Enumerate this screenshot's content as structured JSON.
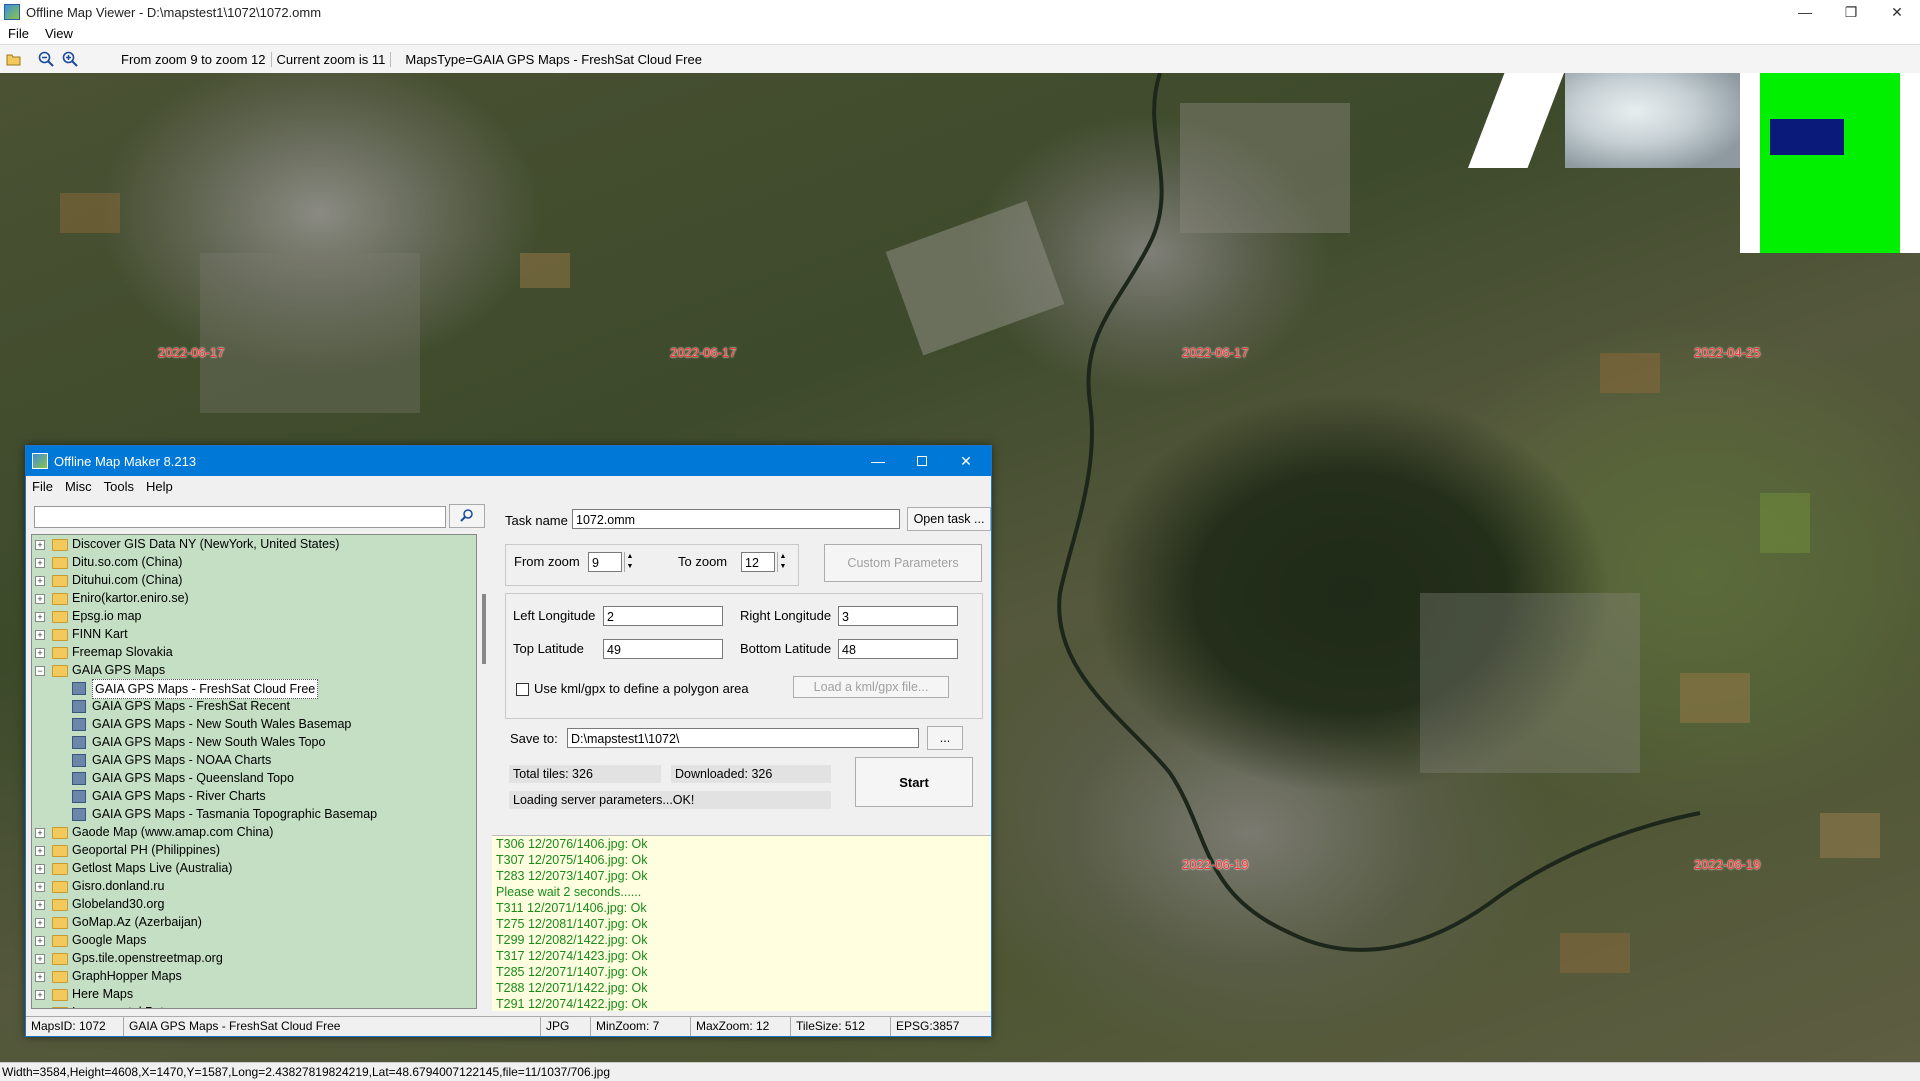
{
  "window": {
    "title": "Offline Map Viewer - D:\\mapstest1\\1072\\1072.omm",
    "minimize": "—",
    "maximize": "❐",
    "close": "✕"
  },
  "menubar": {
    "file": "File",
    "view": "View"
  },
  "toolbar": {
    "zoom_range": "From zoom 9 to zoom 12",
    "current_zoom": "Current zoom is 11",
    "maps_type": "MapsType=GAIA GPS Maps - FreshSat Cloud Free",
    "icons": [
      "folder-open-icon",
      "zoom-out-icon",
      "zoom-in-icon"
    ]
  },
  "map": {
    "date_labels": [
      "2022-06-17",
      "2022-06-17",
      "2022-06-17",
      "2022-04-25",
      "2022-06-19",
      "2022-06-19"
    ]
  },
  "statusbar": {
    "text": "Width=3584,Height=4608,X=1470,Y=1587,Long=2.43827819824219,Lat=48.6794007122145,file=11/1037/706.jpg"
  },
  "dialog": {
    "title": "Offline Map Maker 8.213",
    "menu": [
      "File",
      "Misc",
      "Tools",
      "Help"
    ],
    "search": {
      "value": ""
    },
    "tree": [
      {
        "label": "Discover GIS Data NY (NewYork, United States)",
        "level": 1
      },
      {
        "label": "Ditu.so.com (China)",
        "level": 1
      },
      {
        "label": "Dituhui.com (China)",
        "level": 1
      },
      {
        "label": "Eniro(kartor.eniro.se)",
        "level": 1
      },
      {
        "label": "Epsg.io map",
        "level": 1
      },
      {
        "label": "FINN Kart",
        "level": 1
      },
      {
        "label": "Freemap Slovakia",
        "level": 1
      },
      {
        "label": "GAIA GPS Maps",
        "level": 1,
        "expanded": true
      },
      {
        "label": "GAIA GPS Maps - FreshSat Cloud Free",
        "level": 2,
        "selected": true
      },
      {
        "label": "GAIA GPS Maps - FreshSat Recent",
        "level": 2
      },
      {
        "label": "GAIA GPS Maps - New South Wales Basemap",
        "level": 2
      },
      {
        "label": "GAIA GPS Maps - New South Wales Topo",
        "level": 2
      },
      {
        "label": "GAIA GPS Maps - NOAA Charts",
        "level": 2
      },
      {
        "label": "GAIA GPS Maps - Queensland Topo",
        "level": 2
      },
      {
        "label": "GAIA GPS Maps - River Charts",
        "level": 2
      },
      {
        "label": "GAIA GPS Maps - Tasmania Topographic Basemap",
        "level": 2
      },
      {
        "label": "Gaode Map (www.amap.com China)",
        "level": 1
      },
      {
        "label": "Geoportal PH (Philippines)",
        "level": 1
      },
      {
        "label": "Getlost Maps Live (Australia)",
        "level": 1
      },
      {
        "label": "Gisro.donland.ru",
        "level": 1
      },
      {
        "label": "Globeland30.org",
        "level": 1
      },
      {
        "label": "GoMap.Az (Azerbaijan)",
        "level": 1
      },
      {
        "label": "Google Maps",
        "level": 1
      },
      {
        "label": "Gps.tile.openstreetmap.org",
        "level": 1
      },
      {
        "label": "GraphHopper Maps",
        "level": 1
      },
      {
        "label": "Here Maps",
        "level": 1
      },
      {
        "label": "Inageoportal Peta",
        "level": 1
      }
    ],
    "task_name_label": "Task name",
    "task_name_value": "1072.omm",
    "open_task": "Open task ...",
    "from_zoom_label": "From zoom",
    "from_zoom_value": "9",
    "to_zoom_label": "To zoom",
    "to_zoom_value": "12",
    "custom_params": "Custom Parameters",
    "left_lon_label": "Left Longitude",
    "left_lon_value": "2",
    "right_lon_label": "Right Longitude",
    "right_lon_value": "3",
    "top_lat_label": "Top Latitude",
    "top_lat_value": "49",
    "bottom_lat_label": "Bottom Latitude",
    "bottom_lat_value": "48",
    "use_kml_label": "Use kml/gpx to define a polygon area",
    "load_kml": "Load a kml/gpx file...",
    "save_to_label": "Save to:",
    "save_to_value": "D:\\mapstest1\\1072\\",
    "browse": "...",
    "total_tiles": "Total tiles: 326",
    "downloaded": "Downloaded: 326",
    "loading_status": "Loading server parameters...OK!",
    "start": "Start",
    "log": [
      "T306 12/2076/1406.jpg: Ok",
      "T307 12/2075/1406.jpg: Ok",
      "T283 12/2073/1407.jpg: Ok",
      "Please wait 2 seconds......",
      "T311 12/2071/1406.jpg: Ok",
      "T275 12/2081/1407.jpg: Ok",
      "T299 12/2082/1422.jpg: Ok",
      "T317 12/2074/1423.jpg: Ok",
      "T285 12/2071/1407.jpg: Ok",
      "T288 12/2071/1422.jpg: Ok",
      "T291 12/2074/1422.jpg: Ok"
    ],
    "status": {
      "maps_id": "MapsID: 1072",
      "maps_name": "GAIA GPS Maps - FreshSat Cloud Free",
      "format": "JPG",
      "min_zoom": "MinZoom: 7",
      "max_zoom": "MaxZoom: 12",
      "tile_size": "TileSize: 512",
      "epsg": "EPSG:3857"
    }
  }
}
